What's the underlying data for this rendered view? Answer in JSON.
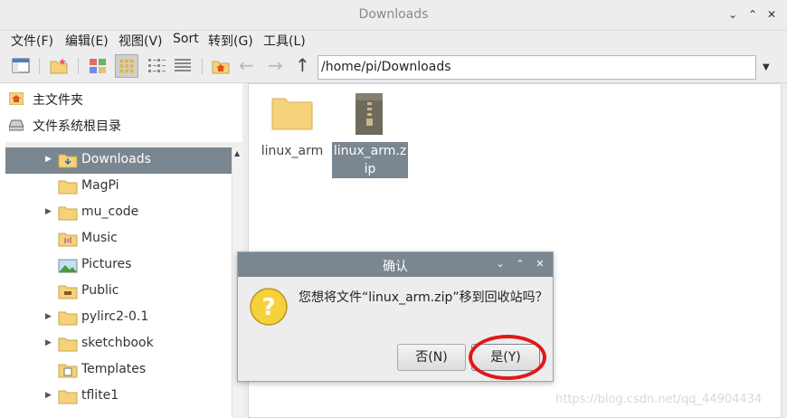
{
  "window": {
    "title": "Downloads",
    "controls": [
      "chevron-down",
      "chevron-up",
      "close"
    ]
  },
  "menu": {
    "items": [
      "文件(F)",
      "编辑(E)",
      "视图(V)",
      "Sort",
      "转到(G)",
      "工具(L)"
    ]
  },
  "toolbar": {
    "address": "/home/pi/Downloads",
    "buttons": [
      "new-window-icon",
      "new-folder-icon",
      "thumbnail-view-icon",
      "icon-view-icon",
      "compact-view-icon",
      "detailed-view-icon",
      "home-icon",
      "back-icon",
      "forward-icon",
      "up-icon"
    ]
  },
  "places": [
    {
      "label": "主文件夹",
      "icon": "home-icon"
    },
    {
      "label": "文件系统根目录",
      "icon": "drive-icon"
    }
  ],
  "tree": [
    {
      "label": "Downloads",
      "expander": true,
      "selected": true,
      "icon": "downloads-folder-icon"
    },
    {
      "label": "MagPi",
      "expander": false,
      "icon": "folder-icon"
    },
    {
      "label": "mu_code",
      "expander": true,
      "icon": "folder-icon"
    },
    {
      "label": "Music",
      "expander": false,
      "icon": "music-folder-icon"
    },
    {
      "label": "Pictures",
      "expander": false,
      "icon": "pictures-folder-icon"
    },
    {
      "label": "Public",
      "expander": false,
      "icon": "public-folder-icon"
    },
    {
      "label": "pylirc2-0.1",
      "expander": true,
      "icon": "folder-icon"
    },
    {
      "label": "sketchbook",
      "expander": true,
      "icon": "folder-icon"
    },
    {
      "label": "Templates",
      "expander": false,
      "icon": "templates-folder-icon"
    },
    {
      "label": "tflite1",
      "expander": true,
      "icon": "folder-icon"
    }
  ],
  "files": [
    {
      "name": "linux_arm",
      "type": "folder",
      "selected": false
    },
    {
      "name": "linux_arm.zip",
      "type": "zip",
      "selected": true
    }
  ],
  "dialog": {
    "title": "确认",
    "message": "您想将文件“linux_arm.zip”移到回收站吗？",
    "no_label": "否(N)",
    "yes_label": "是(Y)",
    "icon": "question-icon"
  },
  "watermark": "https://blog.csdn.net/qq_44904434",
  "colors": {
    "selection": "#7a8690",
    "highlight_ring": "#e01818",
    "folder": "#f5d27a"
  }
}
